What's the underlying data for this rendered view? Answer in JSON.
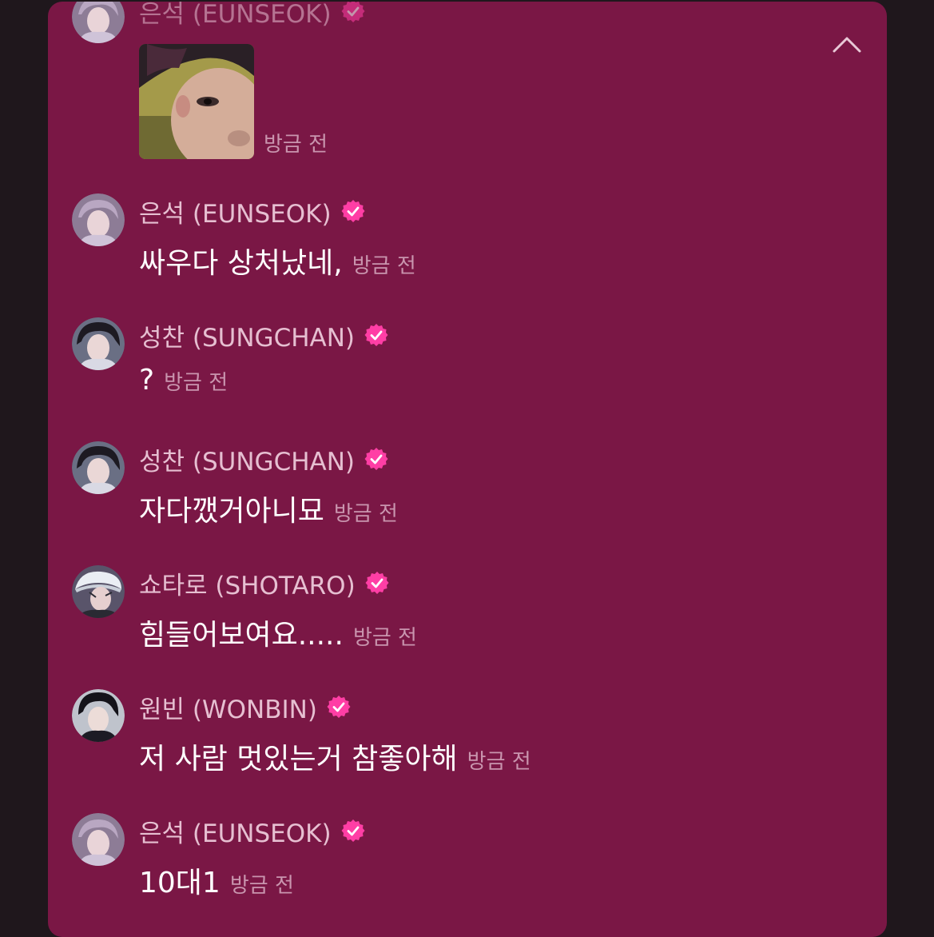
{
  "messages": [
    {
      "sender": "은석 (EUNSEOK)",
      "avatar": "eunseok-avatar",
      "type": "photo",
      "time": "방금 전"
    },
    {
      "sender": "은석 (EUNSEOK)",
      "avatar": "eunseok-avatar",
      "text": "싸우다 상처났네,",
      "time": "방금 전"
    },
    {
      "sender": "성찬 (SUNGCHAN)",
      "avatar": "sungchan-avatar",
      "text": "?",
      "time": "방금 전"
    },
    {
      "sender": "성찬 (SUNGCHAN)",
      "avatar": "sungchan-avatar",
      "text": "자다깼거아니묘",
      "time": "방금 전"
    },
    {
      "sender": "쇼타로 (SHOTARO)",
      "avatar": "shotaro-avatar",
      "text": "힘들어보여요.....",
      "time": "방금 전"
    },
    {
      "sender": "원빈 (WONBIN)",
      "avatar": "wonbin-avatar",
      "text": "저 사람 멋있는거 참좋아해",
      "time": "방금 전"
    },
    {
      "sender": "은석 (EUNSEOK)",
      "avatar": "eunseok-avatar",
      "text": "10대1",
      "time": "방금 전"
    }
  ],
  "icons": {
    "collapse": "chevron-up-icon",
    "verified": "verified-badge-icon"
  },
  "colors": {
    "panel_bg": "#7a1745",
    "page_bg": "#1f171c",
    "badge": "#ff3ea5",
    "sender_text": "#e6bfd1",
    "message_text": "#ffffff",
    "time_text": "#c995ae"
  }
}
